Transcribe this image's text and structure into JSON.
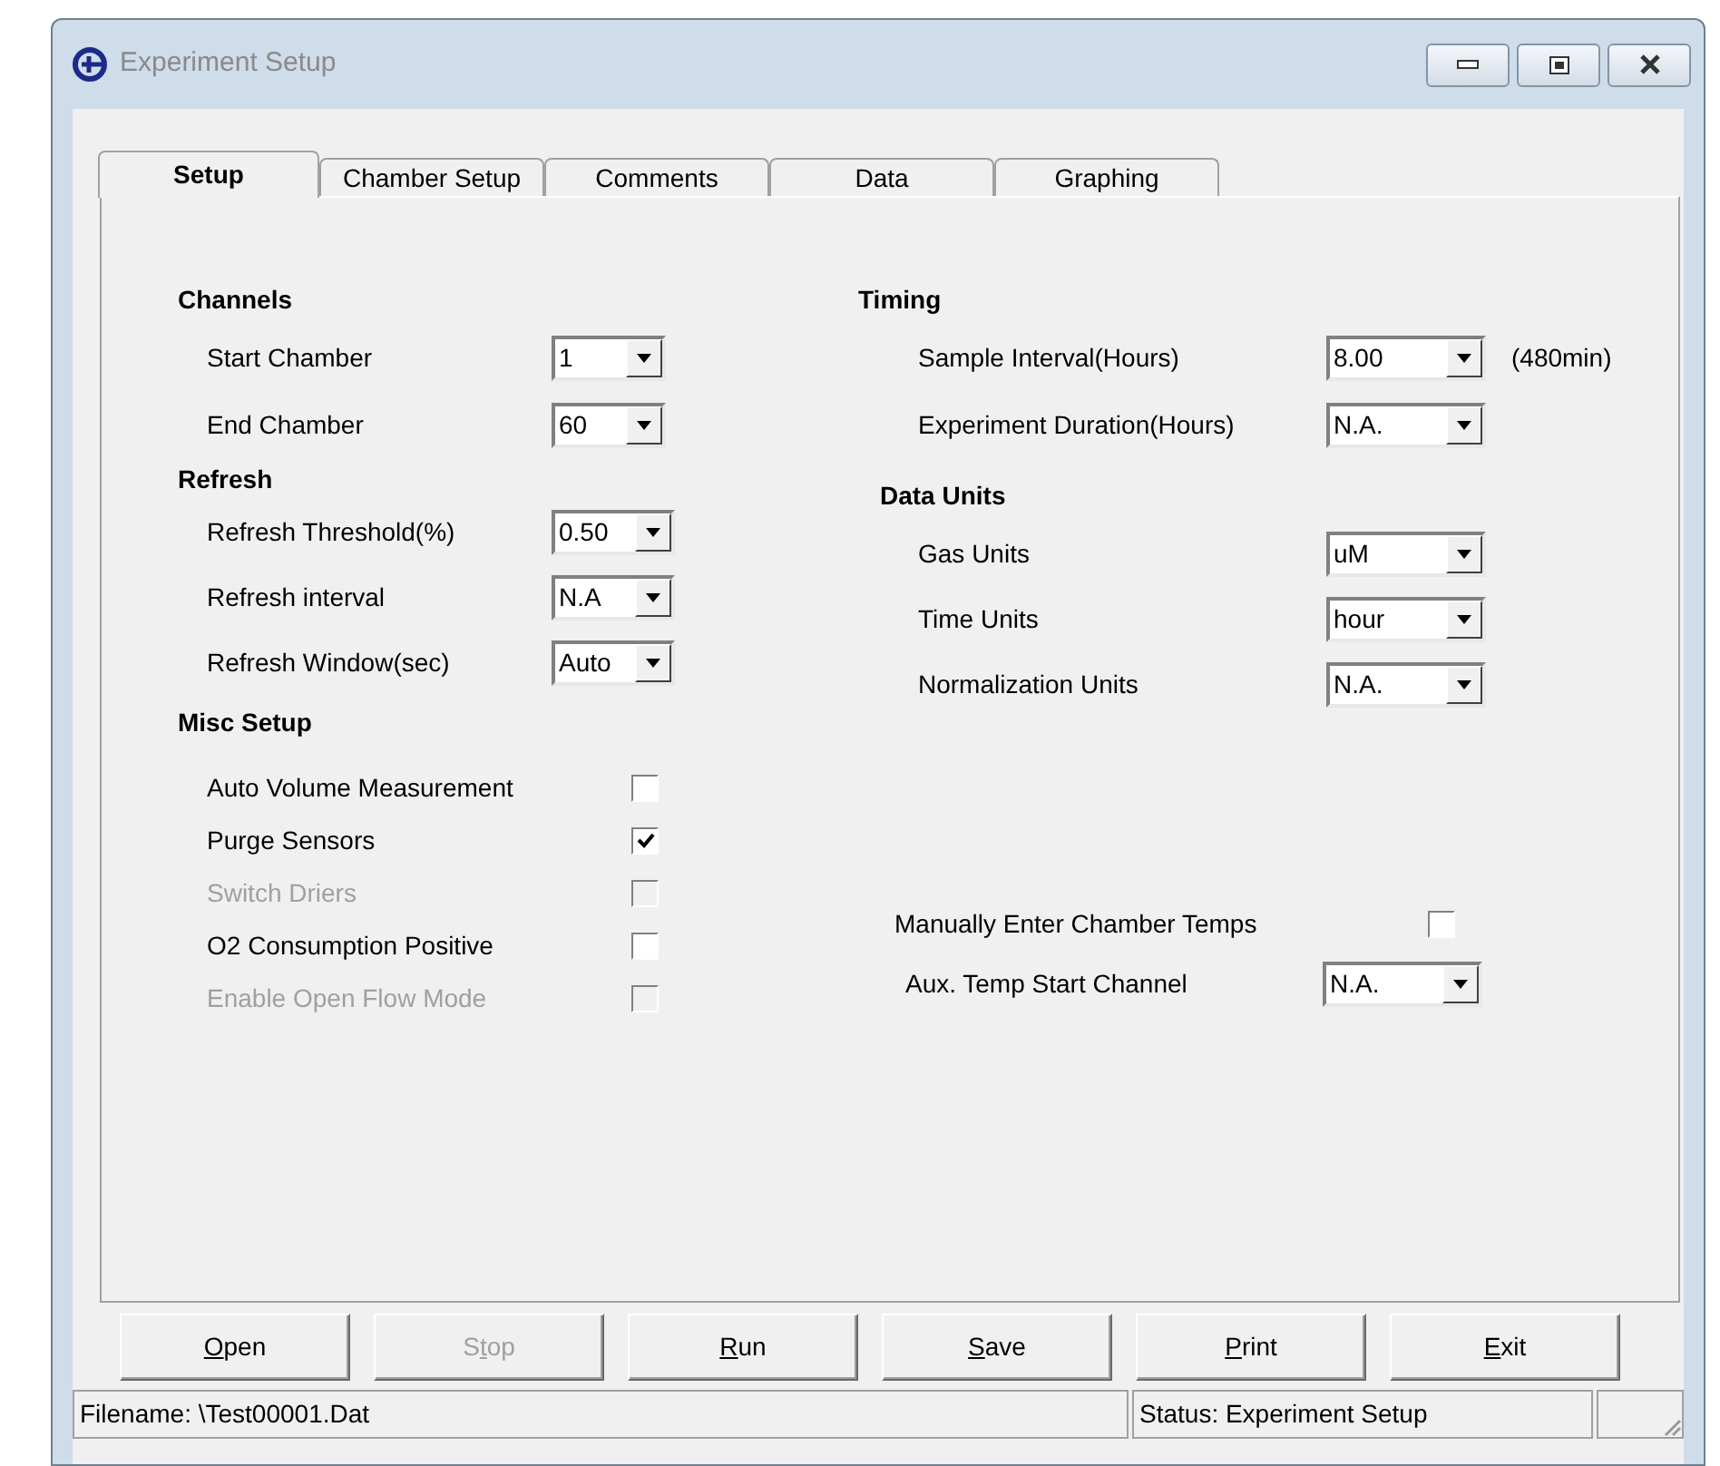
{
  "window": {
    "title": "Experiment Setup"
  },
  "tabs": [
    {
      "label": "Setup",
      "selected": true
    },
    {
      "label": "Chamber Setup",
      "selected": false
    },
    {
      "label": "Comments",
      "selected": false
    },
    {
      "label": "Data",
      "selected": false
    },
    {
      "label": "Graphing",
      "selected": false
    }
  ],
  "left_groups": [
    {
      "heading": "Channels",
      "rows": [
        {
          "kind": "combo",
          "label": "Start Chamber",
          "value": "1"
        },
        {
          "kind": "combo",
          "label": "End Chamber",
          "value": "60"
        }
      ]
    },
    {
      "heading": "Refresh",
      "rows": [
        {
          "kind": "combo",
          "label": "Refresh Threshold(%)",
          "value": "0.50"
        },
        {
          "kind": "combo",
          "label": "Refresh interval",
          "value": "N.A"
        },
        {
          "kind": "combo",
          "label": "Refresh Window(sec)",
          "value": "Auto"
        }
      ]
    },
    {
      "heading": "Misc Setup",
      "rows": [
        {
          "kind": "check",
          "label": "Auto Volume Measurement",
          "checked": false,
          "disabled": false
        },
        {
          "kind": "check",
          "label": "Purge Sensors",
          "checked": true,
          "disabled": false
        },
        {
          "kind": "check",
          "label": "Switch Driers",
          "checked": false,
          "disabled": true
        },
        {
          "kind": "check",
          "label": "O2 Consumption Positive",
          "checked": false,
          "disabled": false
        },
        {
          "kind": "check",
          "label": "Enable Open Flow Mode",
          "checked": false,
          "disabled": true
        }
      ]
    }
  ],
  "right_groups": [
    {
      "heading": "Timing",
      "rows": [
        {
          "kind": "combo",
          "label": "Sample Interval(Hours)",
          "value": "8.00",
          "note": "(480min)"
        },
        {
          "kind": "combo",
          "label": "Experiment Duration(Hours)",
          "value": "N.A."
        }
      ]
    },
    {
      "heading": "Data Units",
      "rows": [
        {
          "kind": "combo",
          "label": "Gas Units",
          "value": "uM"
        },
        {
          "kind": "combo",
          "label": "Time Units",
          "value": "hour"
        },
        {
          "kind": "combo",
          "label": "Normalization Units",
          "value": "N.A."
        }
      ]
    },
    {
      "rows": [
        {
          "kind": "check",
          "label": "Manually Enter Chamber Temps",
          "checked": false,
          "disabled": false
        },
        {
          "kind": "combo",
          "label": "Aux. Temp Start Channel",
          "value": "N.A."
        }
      ]
    }
  ],
  "buttons": [
    {
      "accel": "O",
      "after": "pen",
      "disabled": false
    },
    {
      "before": "S",
      "accel": "t",
      "after": "op",
      "disabled": true
    },
    {
      "accel": "R",
      "after": "un",
      "disabled": false
    },
    {
      "accel": "S",
      "after": "ave",
      "disabled": false
    },
    {
      "accel": "P",
      "after": "rint",
      "disabled": false
    },
    {
      "accel": "E",
      "after": "xit",
      "disabled": false
    }
  ],
  "status_bar": {
    "filename": "Filename: \\Test00001.Dat",
    "status": "Status: Experiment Setup"
  }
}
